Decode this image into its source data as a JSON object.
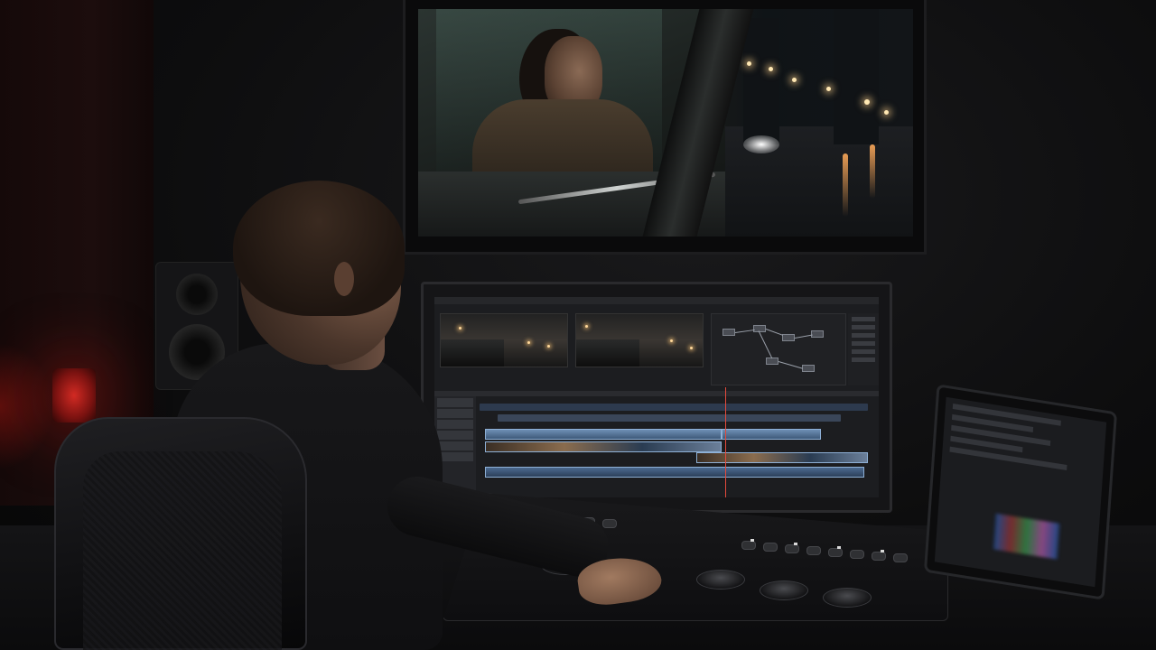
{
  "scene": {
    "description_tags": [
      "color-grading-suite",
      "editor-at-desk"
    ],
    "accent_colors": {
      "wall_lamp": "#d22a23",
      "timeline_clip": "#6e8fb4",
      "playhead": "#e34a3c"
    }
  },
  "edit_ui": {
    "title": ""
  }
}
